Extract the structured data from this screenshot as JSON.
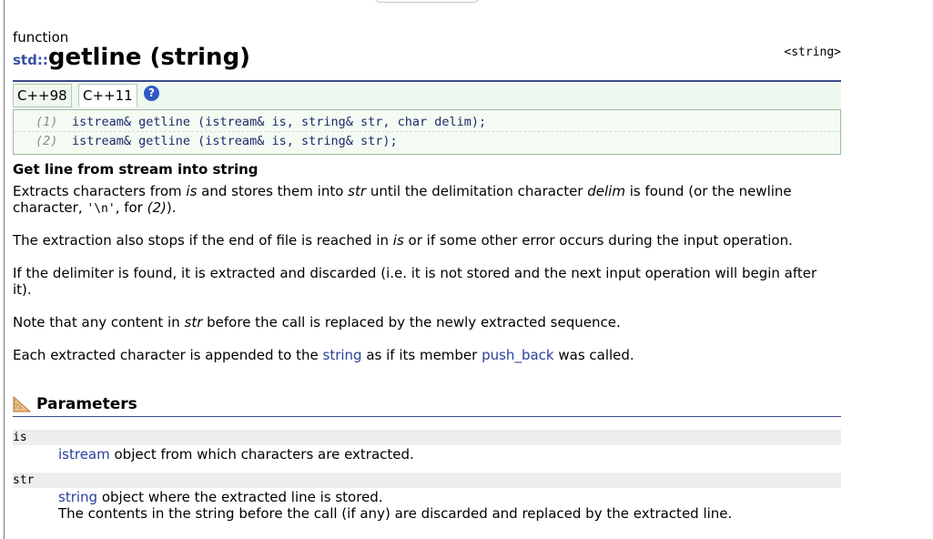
{
  "page": {
    "kind": "function",
    "namespace": "std::",
    "name": "getline (string)",
    "header": "<string>"
  },
  "versions": {
    "tabs": [
      "C++98",
      "C++11"
    ],
    "help_icon": "?"
  },
  "prototypes": [
    {
      "num": "(1)",
      "code": "istream& getline (istream& is, string& str, char delim);"
    },
    {
      "num": "(2)",
      "code": "istream& getline (istream& is, string& str);"
    }
  ],
  "description": {
    "heading": "Get line from stream into string",
    "p1": {
      "a": "Extracts characters from ",
      "is": "is",
      "b": " and stores them into ",
      "str": "str",
      "c": " until the delimitation character ",
      "delim": "delim",
      "d": " is found (or the newline",
      "e": "character, ",
      "nl": "'\\n'",
      "f": ", for ",
      "two": "(2)",
      "g": ")."
    },
    "p2": {
      "a": "The extraction also stops if the end of file is reached in ",
      "is": "is",
      "b": " or if some other error occurs during the input operation."
    },
    "p3": {
      "a": "If the delimiter is found, it is extracted and discarded (i.e. it is not stored and the next input operation will begin after",
      "b": "it)."
    },
    "p4": {
      "a": "Note that any content in ",
      "str": "str",
      "b": " before the call is replaced by the newly extracted sequence."
    },
    "p5": {
      "a": "Each extracted character is appended to the ",
      "string": "string",
      "b": " as if its member ",
      "push_back": "push_back",
      "c": " was called."
    }
  },
  "parameters": {
    "title": "Parameters",
    "icon": "ruler-triangle-icon",
    "items": [
      {
        "name": "is",
        "link": "istream",
        "desc1": " object from which characters are extracted."
      },
      {
        "name": "str",
        "link": "string",
        "desc1": " object where the extracted line is stored.",
        "desc2": "The contents in the string before the call (if any) are discarded and replaced by the extracted line."
      }
    ]
  },
  "colors": {
    "link": "#2a3f9a",
    "rule": "#3a4a8a",
    "version_bar": "#eef8ee",
    "help_icon": "#2f57c5"
  }
}
